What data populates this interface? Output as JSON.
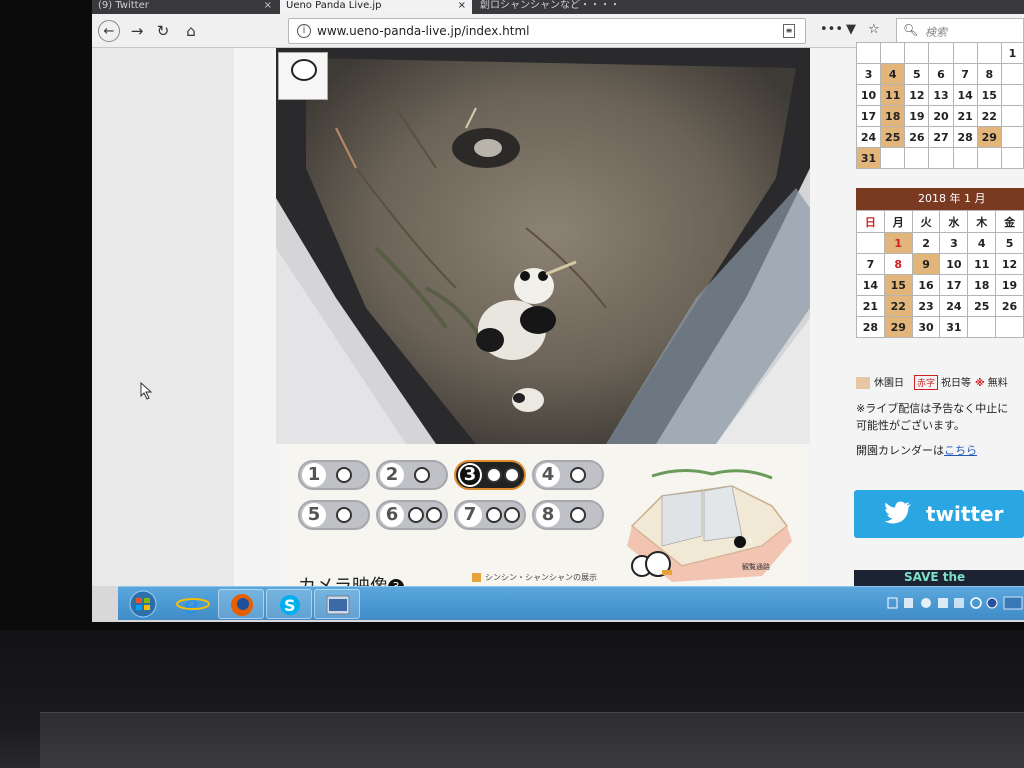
{
  "browser": {
    "tabs": [
      {
        "label": "(9) Twitter",
        "close": "×"
      },
      {
        "label": "Ueno Panda Live.jp",
        "close": "×"
      },
      {
        "label": "創ロシャンシャンなど・・・・",
        "close": ""
      }
    ],
    "url": "www.ueno-panda-live.jp/index.html",
    "search_placeholder": "検索",
    "icons": [
      "back-icon",
      "forward-icon",
      "reload-icon",
      "home-icon",
      "info-icon",
      "reader-icon",
      "menu-dots-icon",
      "pocket-icon",
      "bookmark-star-icon",
      "search-icon"
    ]
  },
  "camera_panel": {
    "buttons": [
      {
        "num": "1",
        "active": false
      },
      {
        "num": "2",
        "active": false
      },
      {
        "num": "3",
        "active": true
      },
      {
        "num": "4",
        "active": false
      },
      {
        "num": "5",
        "active": false
      },
      {
        "num": "6",
        "active": false
      },
      {
        "num": "7",
        "active": false
      },
      {
        "num": "8",
        "active": false
      }
    ],
    "caption": "カメラ映像",
    "caption_num": "3",
    "legend_text": "シンシン・シャンシャンの展示",
    "map_label": "観覧通路",
    "map_marker": "3"
  },
  "calendar_prev": {
    "rows": [
      [
        "",
        "",
        "",
        "",
        "",
        "",
        "1"
      ],
      [
        "3",
        "4",
        "5",
        "6",
        "7",
        "8",
        ""
      ],
      [
        "10",
        "11",
        "12",
        "13",
        "14",
        "15",
        ""
      ],
      [
        "17",
        "18",
        "19",
        "20",
        "21",
        "22",
        ""
      ],
      [
        "24",
        "25",
        "26",
        "27",
        "28",
        "29",
        ""
      ],
      [
        "31",
        "",
        "",
        "",
        "",
        "",
        ""
      ]
    ],
    "closed": [
      "4",
      "11",
      "18",
      "25",
      "29",
      "31"
    ]
  },
  "calendar_jan": {
    "title": "2018 年 1 月",
    "weekdays": [
      "日",
      "月",
      "火",
      "水",
      "木",
      "金"
    ],
    "rows": [
      [
        "",
        "1",
        "2",
        "3",
        "4",
        "5"
      ],
      [
        "7",
        "8",
        "9",
        "10",
        "11",
        "12"
      ],
      [
        "14",
        "15",
        "16",
        "17",
        "18",
        "19"
      ],
      [
        "21",
        "22",
        "23",
        "24",
        "25",
        "26"
      ],
      [
        "28",
        "29",
        "30",
        "31",
        "",
        ""
      ]
    ],
    "closed": [
      "1",
      "9",
      "15",
      "22",
      "29"
    ],
    "red": [
      "1",
      "8"
    ]
  },
  "sidebar": {
    "legend_closed": "休園日",
    "legend_red": "赤字",
    "legend_holiday": "祝日等",
    "legend_mark": "※",
    "legend_free": "無料",
    "note_line1": "※ライブ配信は予告なく中止に",
    "note_line2": "可能性がございます。",
    "calendar_text": "開園カレンダーは",
    "calendar_link": "こちら",
    "twitter_label": "twitter",
    "save_banner": "SAVE the"
  },
  "colors": {
    "twitter": "#2aa6e3",
    "calendar_header": "#7a3a22",
    "closed_day": "#e2b57a",
    "active_camera_border": "#e08a2e"
  }
}
